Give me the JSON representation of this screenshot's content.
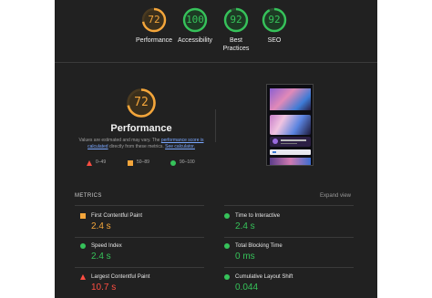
{
  "gauges": [
    {
      "score": "72",
      "label": "Performance",
      "color": "#f4a63b"
    },
    {
      "score": "100",
      "label": "Accessibility",
      "color": "#36c25a"
    },
    {
      "score": "92",
      "label": "Best Practices",
      "color": "#36c25a"
    },
    {
      "score": "92",
      "label": "SEO",
      "color": "#36c25a"
    }
  ],
  "performance": {
    "score": "72",
    "title": "Performance",
    "desc_prefix": "Values are estimated and may vary. The ",
    "desc_link1": "performance score is calculated",
    "desc_mid": " directly from these metrics. ",
    "desc_link2": "See calculator."
  },
  "legend": [
    {
      "range": "0–49",
      "symbol": "triangle",
      "color": "#ff4e42"
    },
    {
      "range": "50–89",
      "symbol": "square",
      "color": "#f4a63b"
    },
    {
      "range": "90–100",
      "symbol": "circle",
      "color": "#36c25a"
    }
  ],
  "metrics": {
    "header": "METRICS",
    "expand_label": "Expand view",
    "items": [
      {
        "name": "First Contentful Paint",
        "value": "2.4 s",
        "status": "average"
      },
      {
        "name": "Time to Interactive",
        "value": "2.4 s",
        "status": "pass"
      },
      {
        "name": "Speed Index",
        "value": "2.4 s",
        "status": "pass"
      },
      {
        "name": "Total Blocking Time",
        "value": "0 ms",
        "status": "pass"
      },
      {
        "name": "Largest Contentful Paint",
        "value": "10.7 s",
        "status": "fail"
      },
      {
        "name": "Cumulative Layout Shift",
        "value": "0.044",
        "status": "pass"
      }
    ]
  },
  "colors": {
    "fail": "#ff4e42",
    "average": "#f4a63b",
    "pass": "#36c25a"
  }
}
